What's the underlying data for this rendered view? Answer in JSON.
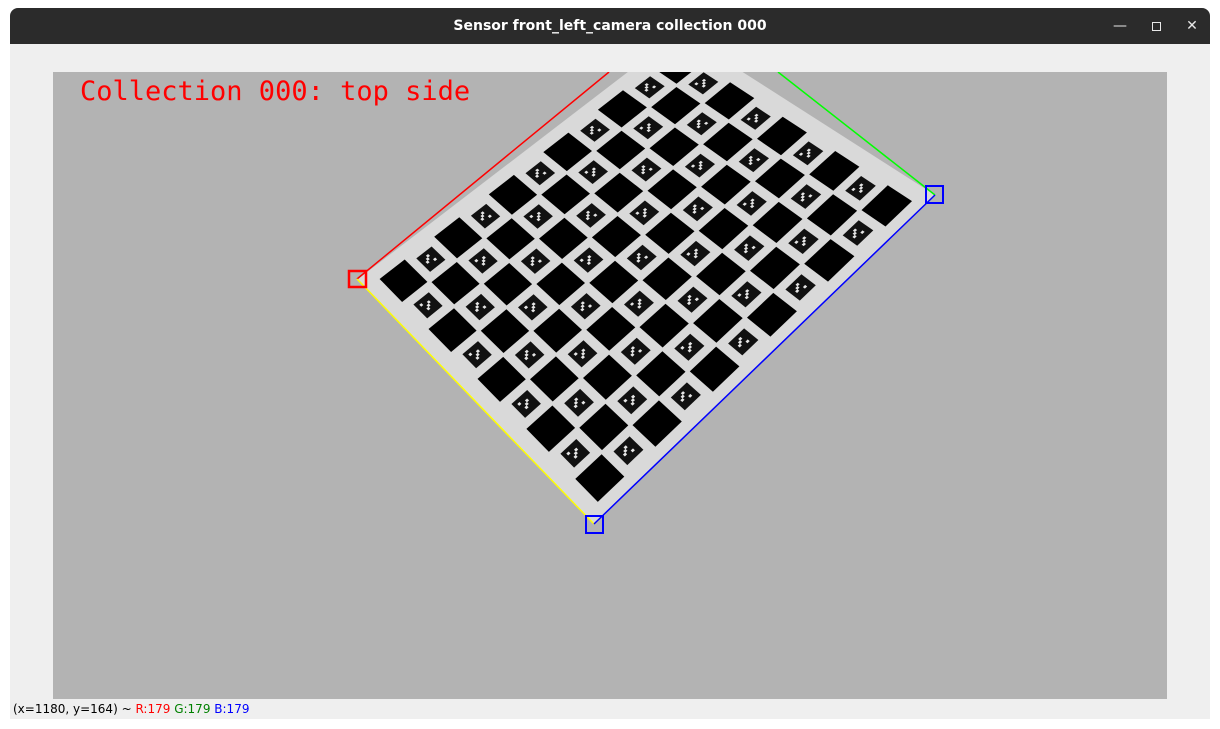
{
  "window": {
    "title": "Sensor front_left_camera collection 000",
    "controls": {
      "minimize_icon": "minimize-icon",
      "maximize_icon": "maximize-icon",
      "close_icon": "close-icon"
    }
  },
  "image": {
    "overlay_text": "Collection 000: top side",
    "overlay_color": "#ff0000",
    "background_color": "#b3b3b3",
    "edge_colors": {
      "top_left": "#ff0000",
      "top_right": "#00ff00",
      "bottom_left": "#ffff00",
      "bottom_right": "#0000ff"
    }
  },
  "statusbar": {
    "coords": "(x=1180, y=164) ~",
    "r": "R:179",
    "g": "G:179",
    "b": "B:179",
    "r_color": "#ff0000",
    "g_color": "#008000",
    "b_color": "#0000ff"
  }
}
